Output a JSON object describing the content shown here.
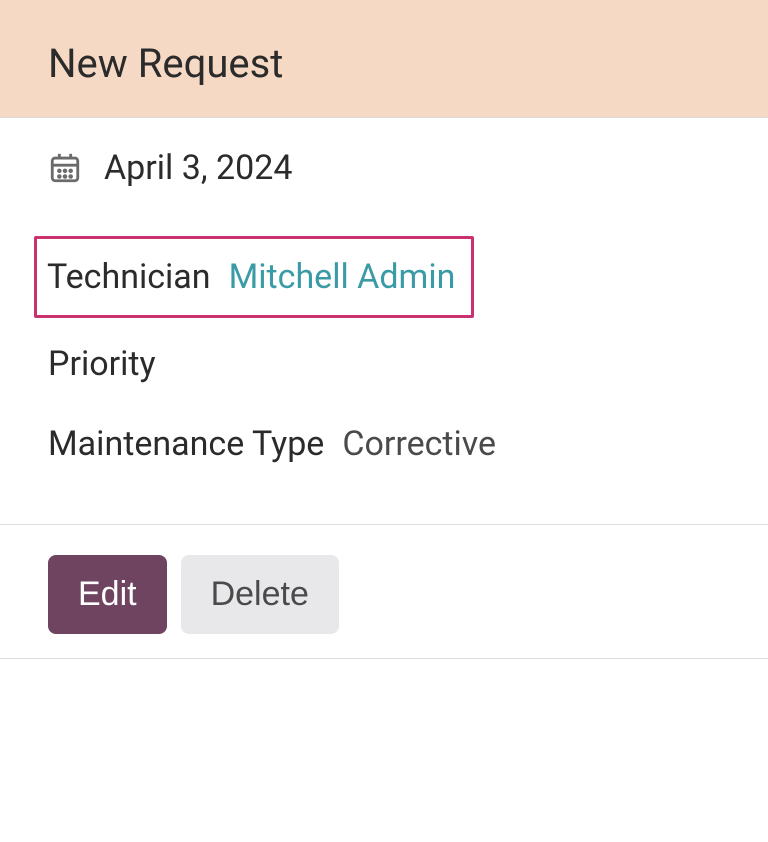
{
  "header": {
    "title": "New Request"
  },
  "date": {
    "value": "April 3, 2024"
  },
  "fields": {
    "technician": {
      "label": "Technician",
      "value": "Mitchell Admin"
    },
    "priority": {
      "label": "Priority",
      "value": ""
    },
    "maintenance_type": {
      "label": "Maintenance Type",
      "value": "Corrective"
    }
  },
  "actions": {
    "edit": "Edit",
    "delete": "Delete"
  }
}
